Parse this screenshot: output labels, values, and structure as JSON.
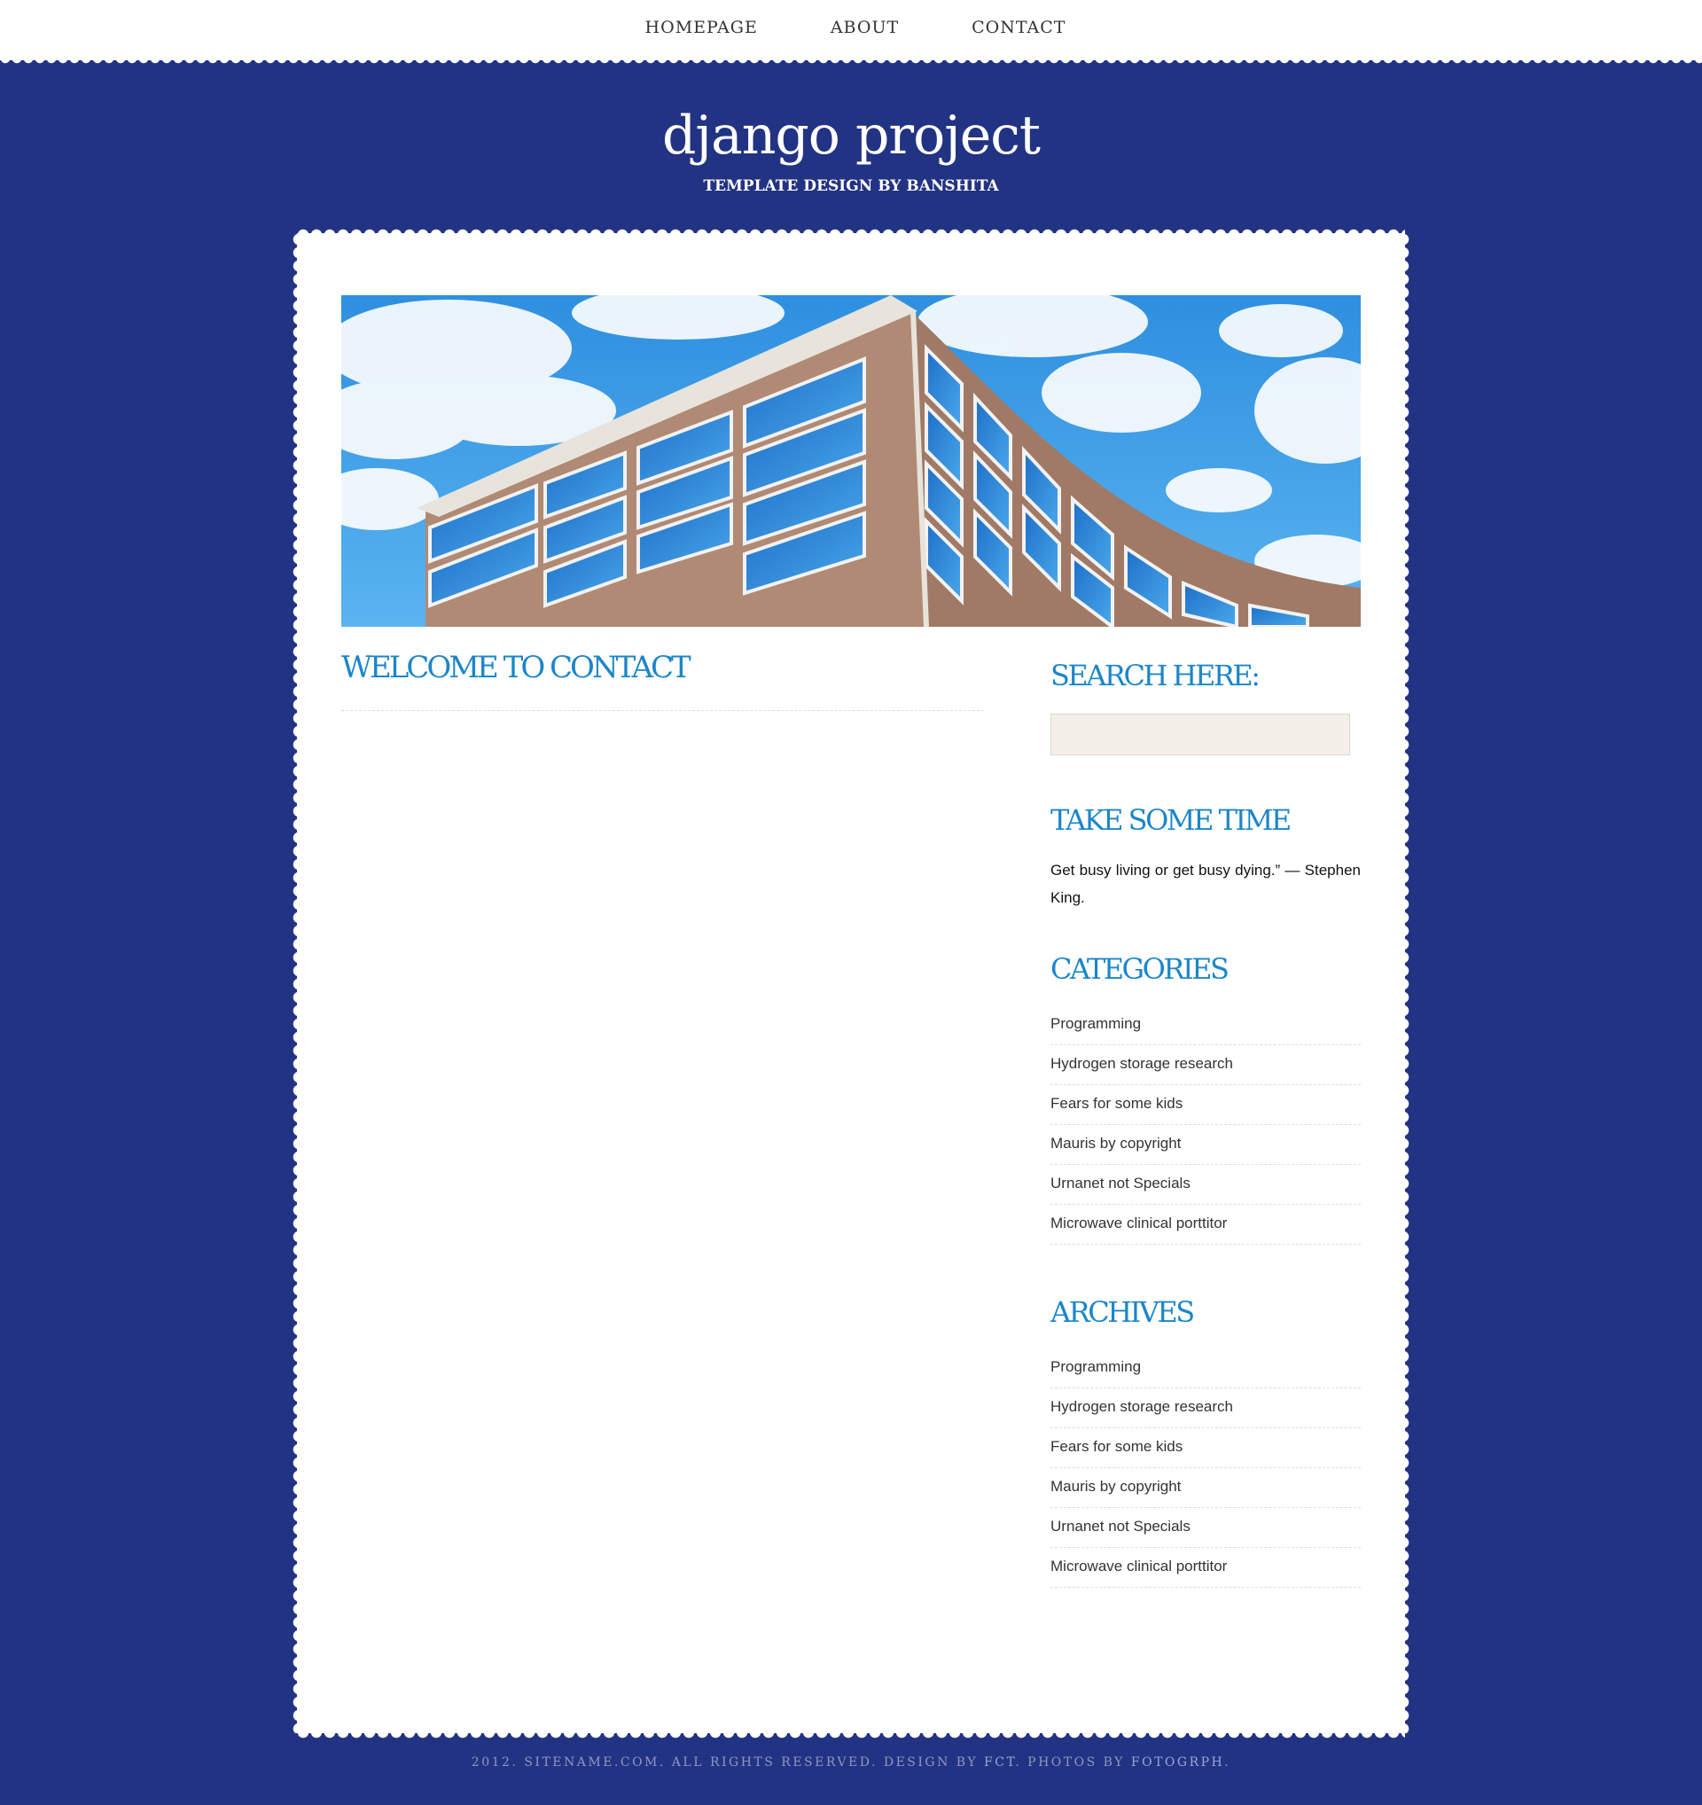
{
  "nav": {
    "items": [
      {
        "label": "HOMEPAGE"
      },
      {
        "label": "ABOUT"
      },
      {
        "label": "CONTACT"
      }
    ]
  },
  "header": {
    "title": "django project",
    "tagline": "TEMPLATE DESIGN BY BANSHITA"
  },
  "main": {
    "heading": "WELCOME TO CONTACT"
  },
  "sidebar": {
    "search": {
      "heading": "SEARCH HERE:",
      "value": "",
      "placeholder": ""
    },
    "quote": {
      "heading": "TAKE SOME TIME",
      "text": "Get busy living or get busy dying.” — Stephen King."
    },
    "categories": {
      "heading": "CATEGORIES",
      "items": [
        "Programming",
        "Hydrogen storage research",
        "Fears for some kids",
        "Mauris by copyright",
        "Urnanet not Specials",
        "Microwave clinical porttitor"
      ]
    },
    "archives": {
      "heading": "ARCHIVES",
      "items": [
        "Programming",
        "Hydrogen storage research",
        "Fears for some kids",
        "Mauris by copyright",
        "Urnanet not Specials",
        "Microwave clinical porttitor"
      ]
    }
  },
  "footer": {
    "text_prefix": "2012. SITENAME.COM. ALL RIGHTS RESERVED. DESIGN BY ",
    "design_link": "FCT",
    "text_middle": ". PHOTOS BY ",
    "photos_link": "FOTOGRPH",
    "text_suffix": "."
  },
  "colors": {
    "background": "#233383",
    "accent": "#1b86c9",
    "card": "#ffffff"
  }
}
